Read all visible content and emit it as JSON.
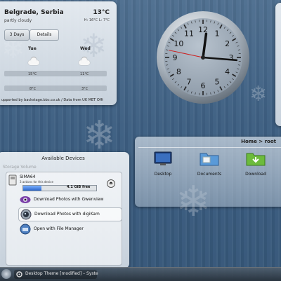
{
  "weather": {
    "city": "Belgrade, Serbia",
    "condition": "partly cloudy",
    "temperature": "13°C",
    "high_low": "H: 16°C L: 7°C",
    "tabs": [
      "3 Days",
      "Details"
    ],
    "active_tab": "3 Days",
    "days": [
      {
        "name": "Tue",
        "icon": "partly-cloudy-icon",
        "high": "15°C",
        "low": "8°C"
      },
      {
        "name": "Wed",
        "icon": "partly-cloudy-icon",
        "high": "11°C",
        "low": "3°C"
      }
    ],
    "credit": "upported by backstage.bbc.co.uk / Data from UK MET Offi"
  },
  "clock": {
    "hour": 12,
    "minute": 15,
    "second": 47,
    "numerals": [
      "12",
      "1",
      "2",
      "3",
      "4",
      "5",
      "6",
      "7",
      "8",
      "9",
      "10",
      "11"
    ]
  },
  "folder": {
    "breadcrumb": "Home > root",
    "items": [
      {
        "label": "Desktop",
        "icon": "desktop-icon"
      },
      {
        "label": "Documents",
        "icon": "folder-icon"
      },
      {
        "label": "Download",
        "icon": "download-folder-icon"
      }
    ]
  },
  "devices": {
    "title": "Available Devices",
    "section": "Storage Volume",
    "device_name": "SIMA64",
    "device_actions": "3 actions for this device",
    "capacity_text": "4.1 GiB free",
    "capacity_used_fraction": 0.25,
    "actions": [
      {
        "label": "Download Photos with Gwenview",
        "icon": "gwenview-icon"
      },
      {
        "label": "Download Photos with digiKam",
        "icon": "digikam-icon"
      },
      {
        "label": "Open with File Manager",
        "icon": "file-manager-icon"
      }
    ]
  },
  "taskbar": {
    "task_label": "Desktop Theme [modified] – Syste"
  },
  "colors": {
    "accent": "#2a64c8",
    "clock_second_hand": "#cc2222",
    "wallpaper": "#3d5f82"
  }
}
